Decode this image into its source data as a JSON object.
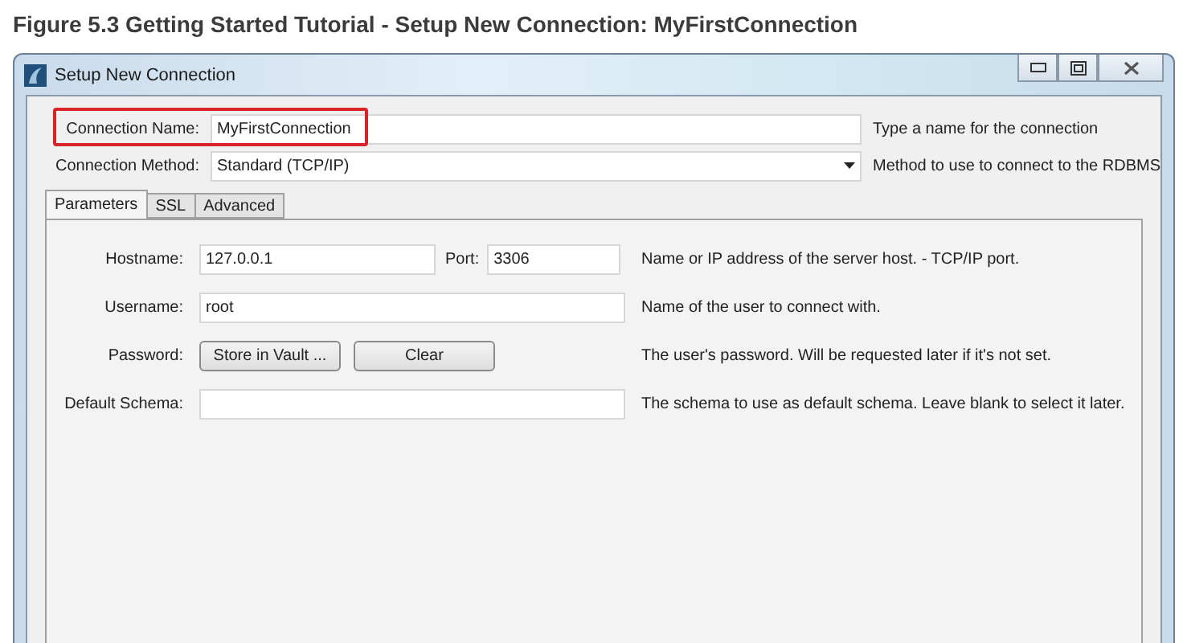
{
  "caption": "Figure 5.3 Getting Started Tutorial - Setup New Connection: MyFirstConnection",
  "window": {
    "title": "Setup New Connection"
  },
  "fields": [
    {
      "kind": "text",
      "label": "Connection Name:",
      "value": "MyFirstConnection",
      "help": "Type a name for the connection",
      "highlighted": true
    },
    {
      "kind": "select",
      "label": "Connection Method:",
      "value": "Standard (TCP/IP)",
      "help": "Method to use to connect to the RDBMS",
      "highlighted": false
    }
  ],
  "tabs": [
    {
      "label": "Parameters",
      "selected": true
    },
    {
      "label": "SSL",
      "selected": false
    },
    {
      "label": "Advanced",
      "selected": false
    }
  ],
  "parameters": [
    {
      "kind": "host",
      "label": "Hostname:",
      "value": "127.0.0.1",
      "port_label": "Port:",
      "port_value": "3306",
      "help": "Name or IP address of the server host. - TCP/IP port."
    },
    {
      "kind": "text",
      "label": "Username:",
      "value": "root",
      "help": "Name of the user to connect with."
    },
    {
      "kind": "buttons",
      "label": "Password:",
      "buttons": [
        "Store in Vault ...",
        "Clear"
      ],
      "help": "The user's password. Will be requested later if it's not set."
    },
    {
      "kind": "text",
      "label": "Default Schema:",
      "help": "The schema to use as default schema. Leave blank to select it later."
    }
  ]
}
